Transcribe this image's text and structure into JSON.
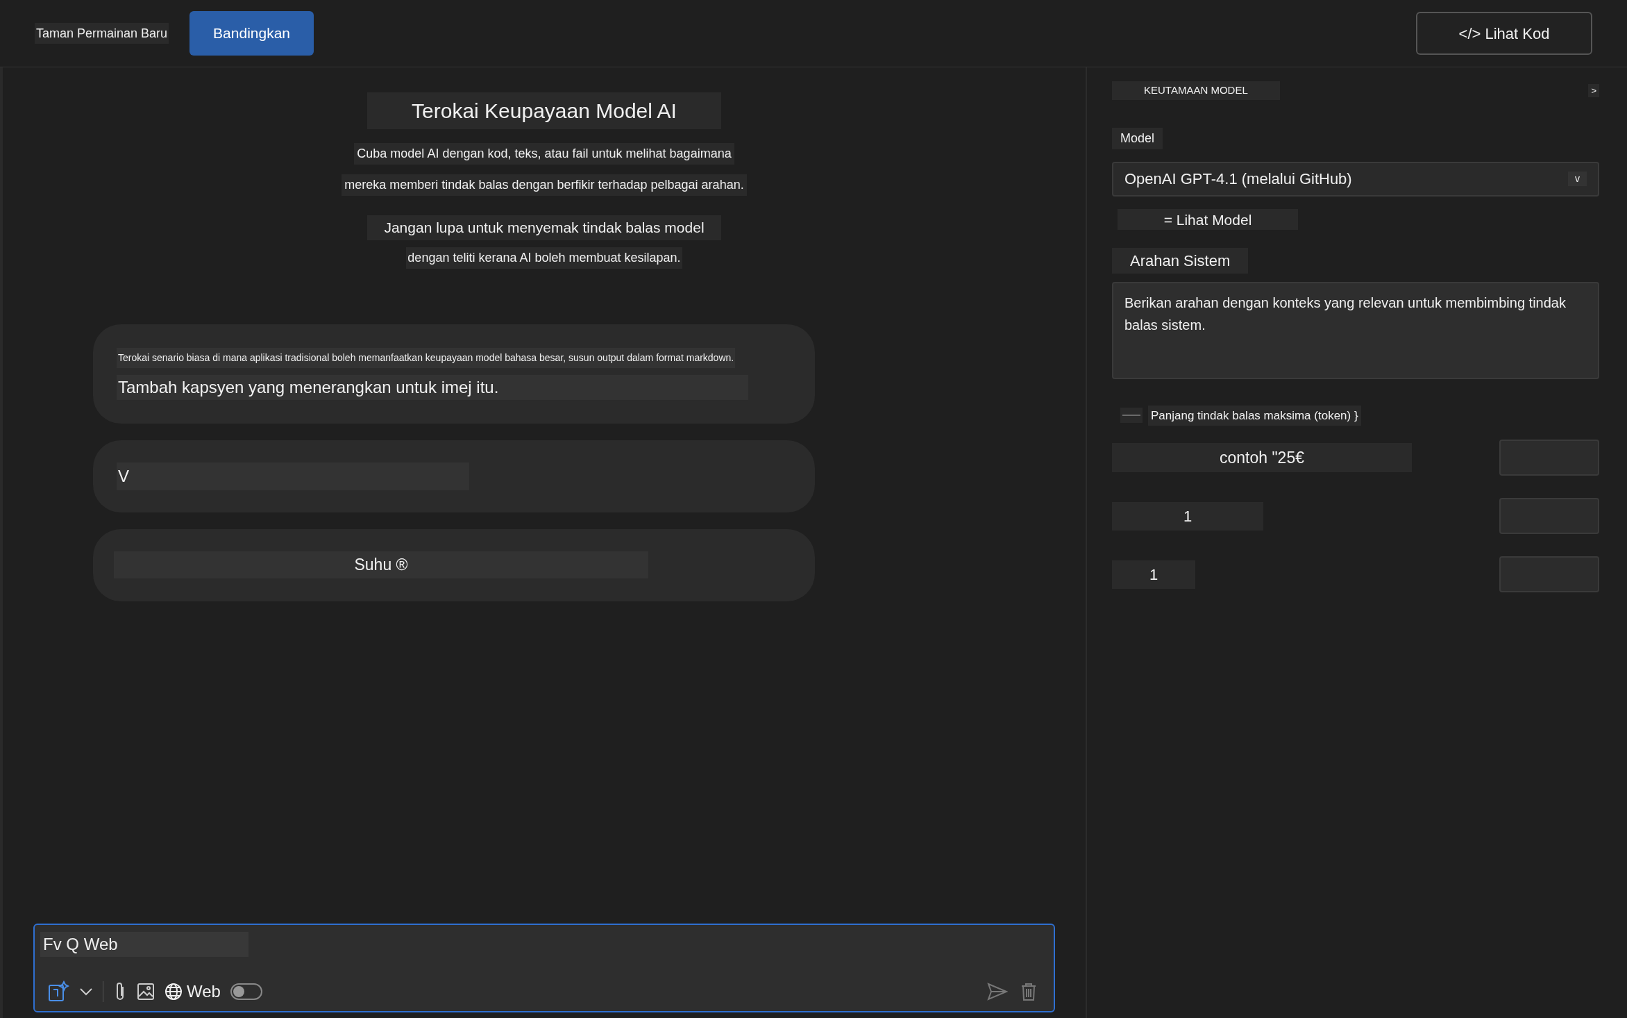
{
  "header": {
    "tabs": [
      {
        "label": "Taman Permainan Baru",
        "selected": false
      },
      {
        "label": "Bandingkan",
        "selected": true
      }
    ],
    "code_button": "</> Lihat Kod"
  },
  "intro": {
    "title": "Terokai Keupayaan Model AI",
    "description": [
      "Cuba model AI dengan kod, teks, atau fail untuk melihat bagaimana",
      "mereka memberi tindak balas dengan berfikir terhadap pelbagai arahan."
    ],
    "warning": [
      "Jangan lupa untuk menyemak tindak balas model",
      "dengan teliti kerana AI boleh membuat kesilapan."
    ]
  },
  "cards": [
    {
      "kind": "prompt",
      "texts": [
        "Terokai senario biasa di mana aplikasi tradisional boleh memanfaatkan keupayaan model bahasa besar, susun output dalam format markdown.",
        "Tambah kapsyen yang menerangkan untuk imej itu."
      ]
    },
    {
      "kind": "field",
      "texts": [
        "V"
      ]
    },
    {
      "kind": "centered",
      "texts": [
        "Suhu ®"
      ]
    }
  ],
  "composer": {
    "value": "Fv Q Web",
    "web_label": "Web",
    "web_on": false
  },
  "settings": {
    "heading": "KEUTAMAAN MODEL",
    "collapse": ">",
    "model_label": "Model",
    "model": "OpenAI GPT-4.1 (melalui GitHub)",
    "chevron": "v",
    "view_models": "= Lihat Model",
    "system_label": "Arahan Sistem",
    "system_prompt": "Berikan arahan dengan konteks yang relevan untuk membimbing tindak balas sistem.",
    "max_tokens_label": "Panjang tindak balas maksima (token) }",
    "params": [
      {
        "label": "contoh \"25€"
      },
      {
        "label": "1"
      },
      {
        "label": "1"
      }
    ]
  }
}
